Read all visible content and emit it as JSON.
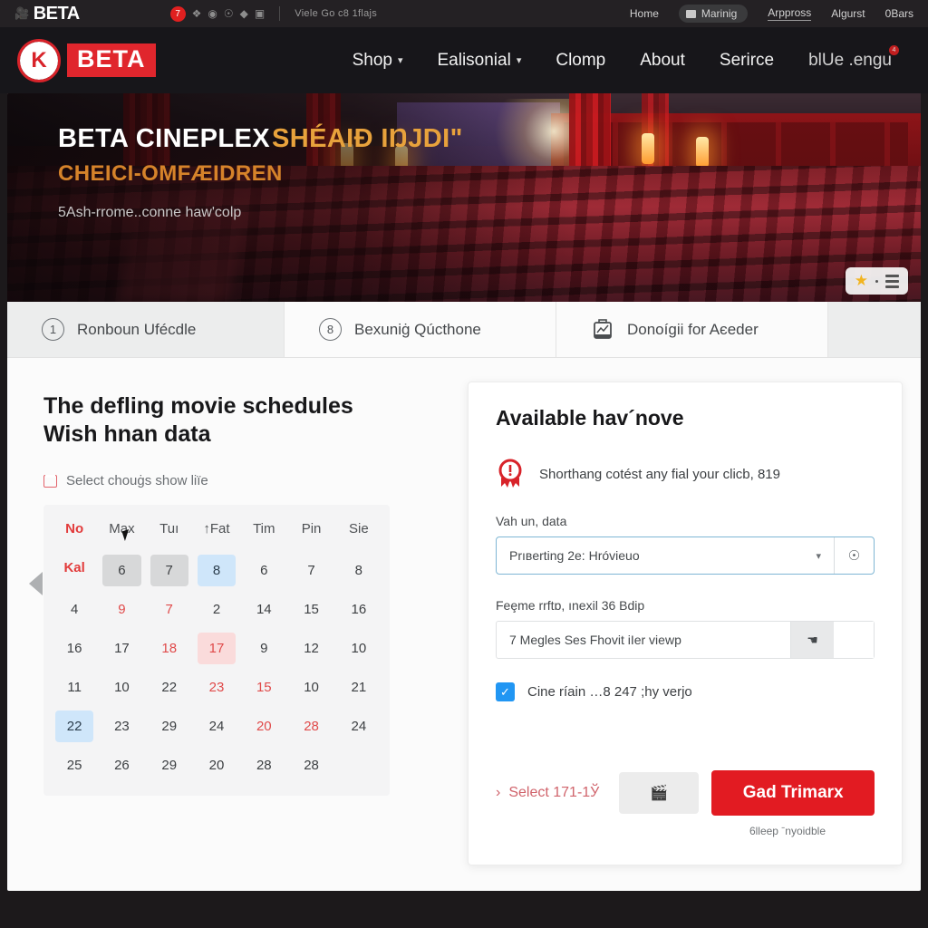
{
  "utility_bar": {
    "brand": "BETA",
    "brand_glyph": "film-icon",
    "badge": "7",
    "icons": [
      "puzzle-icon",
      "clock-icon",
      "help-icon",
      "location-icon",
      "card-icon"
    ],
    "note": "Viele Go c8 1flajs",
    "links": [
      "Home",
      "Marinig",
      "Arppross",
      "Algurst",
      "0Bars"
    ]
  },
  "nav": {
    "logo_mark": "K",
    "logo_word": "BETA",
    "links": [
      {
        "label": "Shop",
        "caret": "⌄"
      },
      {
        "label": "Ealisonial",
        "caret": "⌄"
      },
      {
        "label": "Clomp",
        "caret": ""
      },
      {
        "label": "About",
        "caret": ""
      },
      {
        "label": "Serirce",
        "caret": ""
      },
      {
        "label": "blUe .engu",
        "caret": "",
        "badge": "4"
      }
    ]
  },
  "hero": {
    "title_white": "BETA CINEPLEX",
    "title_amber": "SHÉAIĐ IŊJDI\"",
    "subtitle": "CHEICI-OMFÆIDREN",
    "tagline": "5Ash-rrome..conne haw'colp",
    "fab": {
      "star": "star-icon",
      "menu": "list-icon"
    }
  },
  "steps": [
    {
      "marker": "1",
      "label": "Ronboun Ufécdle",
      "type": "number",
      "active": true
    },
    {
      "marker": "8",
      "label": "Bexuniġ Qúcthone",
      "type": "number",
      "active": false
    },
    {
      "marker": "briefcase-icon",
      "label": "Donoígii for Aєeder",
      "type": "icon",
      "active": false
    }
  ],
  "left_panel": {
    "title_line1": "The defling movie schedules",
    "title_line2": "Wish hnan data",
    "subtitle": "Select chouġs show liïe",
    "calendar": {
      "headers": [
        "No",
        "Max",
        "Tuı",
        "↑Fat",
        "Tim",
        "Pin",
        "Sie",
        "Kal"
      ],
      "weeks": [
        [
          {
            "d": "6",
            "style": "grey"
          },
          {
            "d": "7",
            "style": "grey"
          },
          {
            "d": "8",
            "style": "blue"
          },
          {
            "d": "6",
            "style": ""
          },
          {
            "d": "7",
            "style": ""
          },
          {
            "d": "8",
            "style": ""
          },
          {
            "d": "4",
            "style": ""
          },
          {
            "d": "9",
            "style": "red"
          }
        ],
        [
          {
            "d": "7",
            "style": "red"
          },
          {
            "d": "2",
            "style": ""
          },
          {
            "d": "14",
            "style": ""
          },
          {
            "d": "15",
            "style": ""
          },
          {
            "d": "16",
            "style": ""
          },
          {
            "d": "16",
            "style": ""
          },
          {
            "d": "17",
            "style": ""
          },
          {
            "d": "18",
            "style": "red"
          }
        ],
        [
          {
            "d": "17",
            "style": "pink"
          },
          {
            "d": "9",
            "style": ""
          },
          {
            "d": "12",
            "style": ""
          },
          {
            "d": "10",
            "style": ""
          },
          {
            "d": "11",
            "style": ""
          },
          {
            "d": "10",
            "style": ""
          },
          {
            "d": "22",
            "style": ""
          },
          {
            "d": "23",
            "style": "red"
          }
        ],
        [
          {
            "d": "15",
            "style": "red"
          },
          {
            "d": "10",
            "style": ""
          },
          {
            "d": "21",
            "style": ""
          },
          {
            "d": "22",
            "style": "blue"
          },
          {
            "d": "23",
            "style": ""
          },
          {
            "d": "29",
            "style": ""
          },
          {
            "d": "24",
            "style": ""
          },
          {
            "d": "20",
            "style": "red"
          }
        ],
        [
          {
            "d": "28",
            "style": "red"
          },
          {
            "d": "24",
            "style": ""
          },
          {
            "d": "25",
            "style": ""
          },
          {
            "d": "26",
            "style": ""
          },
          {
            "d": "29",
            "style": ""
          },
          {
            "d": "20",
            "style": ""
          },
          {
            "d": "28",
            "style": ""
          },
          {
            "d": "28",
            "style": ""
          }
        ]
      ]
    }
  },
  "right_panel": {
    "title": "Available hav´nove",
    "alert": {
      "icon": "warning-badge-icon",
      "text": "Shorthang cotést any fial your clicb, 819"
    },
    "select_field": {
      "label": "Vah un, data",
      "value": "Prıвerting 2e: Hróvieuo",
      "caret": "▾",
      "addon_icon": "stamp-icon"
    },
    "text_field": {
      "label": "Feȩme rrftɒ, ınexil 36 Bdip",
      "value": "7 Megles Seѕ Fhovit iIer viewp",
      "button_icon": "pointer-icon"
    },
    "checkbox": {
      "checked": true,
      "label": "Cine ríain …8 247 ;hy verjo"
    },
    "actions": {
      "back_link": "Select 171-1Ў",
      "back_caret": "›",
      "ghost_icon": "ticket-icon",
      "primary_label": "Gad Trimarx"
    },
    "footnote": "6lleep ˉnyoidble"
  },
  "colors": {
    "brand_red": "#e0262d",
    "primary_red": "#e21b22",
    "accent_amber": "#e08a2c",
    "checkbox_blue": "#2196f3",
    "select_border": "#7fb6d4"
  }
}
